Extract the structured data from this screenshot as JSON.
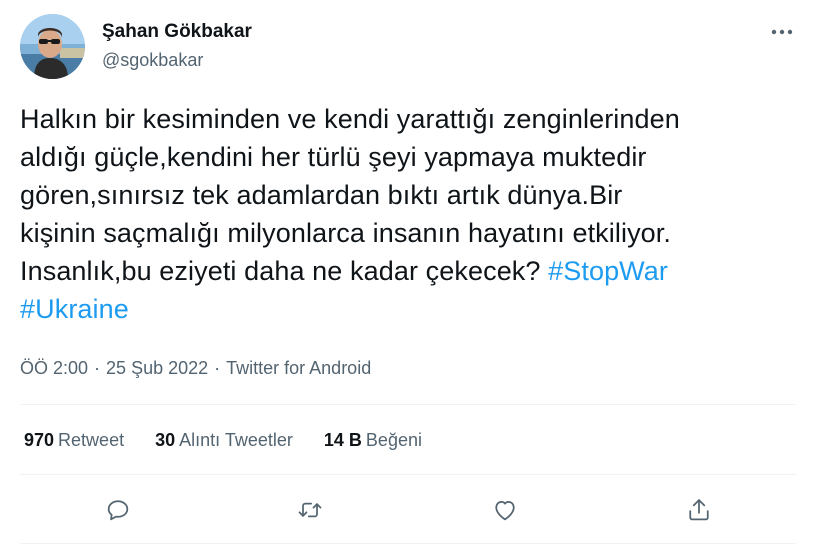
{
  "author": {
    "display_name": "Şahan Gökbakar",
    "username": "@sgokbakar"
  },
  "tweet": {
    "lines": [
      {
        "text": "Halkın bir kesiminden ve kendi yarattığı zenginlerinden"
      },
      {
        "text": "aldığı güçle,kendini her türlü şeyi yapmaya muktedir"
      },
      {
        "text": "gören,sınırsız tek adamlardan bıktı artık dünya.Bir"
      },
      {
        "text": "kişinin saçmalığı milyonlarca insanın hayatını etkiliyor."
      },
      {
        "text": "Insanlık,bu eziyeti daha ne kadar çekecek? "
      }
    ],
    "hashtags": [
      "#StopWar",
      "#Ukraine"
    ]
  },
  "meta": {
    "time": "ÖÖ 2:00",
    "separator": "·",
    "date": "25 Şub 2022",
    "source": "Twitter for Android"
  },
  "stats": {
    "retweets": {
      "num": "970",
      "label": "Retweet"
    },
    "quotes": {
      "num": "30",
      "label": "Alıntı Tweetler"
    },
    "likes": {
      "num": "14 B",
      "label": "Beğeni"
    }
  },
  "icons": {
    "more": "more-horizontal-icon",
    "reply": "reply-icon",
    "retweet": "retweet-icon",
    "like": "heart-icon",
    "share": "share-icon"
  },
  "colors": {
    "hashtag": "#1d9bf0",
    "secondary_text": "#536471",
    "primary_text": "#0f1419",
    "divider": "#eff3f4"
  }
}
